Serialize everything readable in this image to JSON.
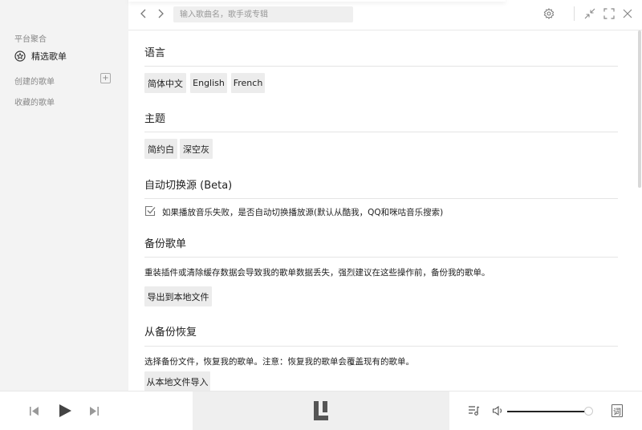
{
  "sidebar": {
    "section_platform": "平台聚合",
    "featured_playlist": "精选歌单",
    "created_playlists": "创建的歌单",
    "add_symbol": "+",
    "collected_playlists": "收藏的歌单"
  },
  "topbar": {
    "search_placeholder": "输入歌曲名，歌手或专辑",
    "icons": [
      "chevron-left-icon",
      "chevron-right-icon",
      "gear-icon",
      "minimize-icon",
      "fullscreen-icon",
      "close-icon"
    ]
  },
  "settings": {
    "language": {
      "title": "语言",
      "options": [
        "简体中文",
        "English",
        "French"
      ]
    },
    "theme": {
      "title": "主题",
      "options": [
        "简约白",
        "深空灰"
      ]
    },
    "auto_switch": {
      "title": "自动切换源 (Beta)",
      "checkbox_label": "如果播放音乐失败，是否自动切换播放源(默认从酷我，QQ和咪咕音乐搜索)",
      "checked": true
    },
    "backup": {
      "title": "备份歌单",
      "description": "重装插件或清除缓存数据会导致我的歌单数据丢失，强烈建议在这些操作前，备份我的歌单。",
      "button": "导出到本地文件"
    },
    "restore": {
      "title": "从备份恢复",
      "description": "选择备份文件，恢复我的歌单。注意：恢复我的歌单会覆盖现有的歌单。",
      "button": "从本地文件导入"
    }
  },
  "player": {
    "lyric_label": "词",
    "volume_fraction": 0.97
  },
  "colors": {
    "sidebar_bg": "#f3f3f3",
    "chip_bg": "#ececec",
    "text": "#222222"
  }
}
